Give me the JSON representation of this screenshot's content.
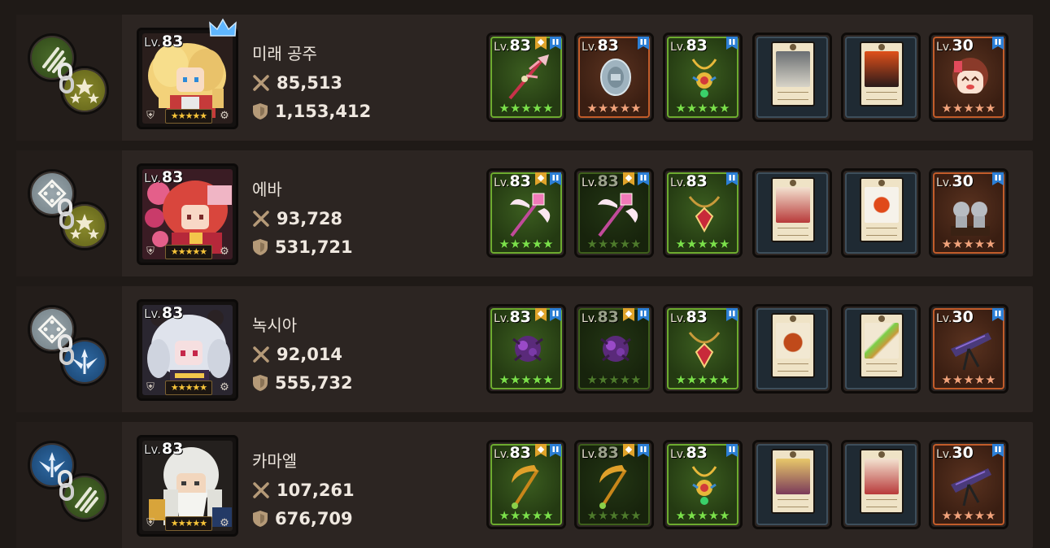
{
  "colors": {
    "background": "#1f1a17",
    "panel": "#2c2522",
    "star_gold": "#f6c339",
    "gear_green": "#6dab2f",
    "gear_orange": "#c25c2a",
    "badge_blue": "#2c7fd6"
  },
  "level_prefix": "Lv.",
  "heroes": [
    {
      "name": "미래 공주",
      "level": "83",
      "atk": "85,513",
      "def": "1,153,412",
      "stars": "★★★★★",
      "crown": true,
      "chain_icons": [
        "claw-icon",
        "triple-star-icon"
      ],
      "class_icon": "shield-class-icon",
      "element_icon": "gear-element-icon",
      "gear": [
        {
          "type": "weapon",
          "level": "83",
          "frame": "green",
          "icon": "spear-icon",
          "stars": "★★★★★",
          "badges": [
            "blue",
            "gold"
          ]
        },
        {
          "type": "armor",
          "level": "83",
          "frame": "orange",
          "icon": "shield-plate-icon",
          "stars": "★★★★★",
          "badges": [
            "blue"
          ]
        },
        {
          "type": "accessory",
          "level": "83",
          "frame": "green",
          "icon": "amulet-icon",
          "stars": "★★★★★",
          "badges": [
            "blue"
          ]
        },
        {
          "type": "card",
          "frame": "card",
          "icon": "old-man-card-icon"
        },
        {
          "type": "card",
          "frame": "card",
          "icon": "demon-card-icon"
        },
        {
          "type": "relic",
          "level": "30",
          "frame": "orange",
          "icon": "girl-doll-icon",
          "stars": "★★★★★",
          "badges": [
            "blue"
          ]
        }
      ]
    },
    {
      "name": "에바",
      "level": "83",
      "atk": "93,728",
      "def": "531,721",
      "stars": "★★★★★",
      "crown": false,
      "chain_icons": [
        "dice-icon",
        "triple-star-icon"
      ],
      "class_icon": "tree-class-icon",
      "element_icon": "diamond-element-icon",
      "gear": [
        {
          "type": "weapon",
          "level": "83",
          "frame": "green",
          "icon": "winged-staff-icon",
          "stars": "★★★★★",
          "badges": [
            "blue",
            "gold"
          ]
        },
        {
          "type": "weapon",
          "level": "83",
          "frame": "green-dim",
          "icon": "winged-staff-icon",
          "stars": "★★★★★",
          "badges": [
            "blue",
            "gold"
          ]
        },
        {
          "type": "accessory",
          "level": "83",
          "frame": "green",
          "icon": "ruby-necklace-icon",
          "stars": "★★★★★",
          "badges": [
            "blue"
          ]
        },
        {
          "type": "card",
          "frame": "card",
          "icon": "fox-girl-card-icon"
        },
        {
          "type": "card",
          "frame": "card",
          "icon": "food-plate-card-icon"
        },
        {
          "type": "relic",
          "level": "30",
          "frame": "orange",
          "icon": "twin-statue-icon",
          "stars": "★★★★★",
          "badges": [
            "blue"
          ]
        }
      ]
    },
    {
      "name": "녹시아",
      "level": "83",
      "atk": "92,014",
      "def": "555,732",
      "stars": "★★★★★",
      "crown": false,
      "chain_icons": [
        "dice-icon",
        "winged-arrow-icon"
      ],
      "class_icon": "tree-class-icon",
      "element_icon": "moon-element-icon",
      "gear": [
        {
          "type": "weapon",
          "level": "83",
          "frame": "green",
          "icon": "dark-orb-icon",
          "stars": "★★★★★",
          "badges": [
            "blue",
            "gold"
          ]
        },
        {
          "type": "weapon",
          "level": "83",
          "frame": "green-dim",
          "icon": "dark-orb-icon",
          "stars": "★★★★★",
          "badges": [
            "blue",
            "gold"
          ]
        },
        {
          "type": "accessory",
          "level": "83",
          "frame": "green",
          "icon": "ruby-necklace-icon",
          "stars": "★★★★★",
          "badges": [
            "blue"
          ]
        },
        {
          "type": "card",
          "frame": "card",
          "icon": "jar-card-icon"
        },
        {
          "type": "card",
          "frame": "card",
          "icon": "sword-card-icon"
        },
        {
          "type": "relic",
          "level": "30",
          "frame": "orange",
          "icon": "dark-blade-stand-icon",
          "stars": "★★★★★",
          "badges": [
            "blue"
          ]
        }
      ]
    },
    {
      "name": "카마엘",
      "level": "83",
      "atk": "107,261",
      "def": "676,709",
      "stars": "★★★★★",
      "crown": false,
      "chain_icons": [
        "winged-arrow-icon",
        "claw-icon"
      ],
      "class_icon": "tree-class-icon",
      "element_icon": "mountain-element-icon",
      "gear": [
        {
          "type": "weapon",
          "level": "83",
          "frame": "green",
          "icon": "golden-scythe-icon",
          "stars": "★★★★★",
          "badges": [
            "blue",
            "gold"
          ]
        },
        {
          "type": "weapon",
          "level": "83",
          "frame": "green-dim",
          "icon": "golden-scythe-icon",
          "stars": "★★★★★",
          "badges": [
            "blue",
            "gold"
          ]
        },
        {
          "type": "accessory",
          "level": "83",
          "frame": "green",
          "icon": "amulet-icon",
          "stars": "★★★★★",
          "badges": [
            "blue"
          ]
        },
        {
          "type": "card",
          "frame": "card",
          "icon": "blonde-girl-card-icon"
        },
        {
          "type": "card",
          "frame": "card",
          "icon": "fox-girl-card-icon"
        },
        {
          "type": "relic",
          "level": "30",
          "frame": "orange",
          "icon": "dark-blade-stand-icon",
          "stars": "★★★★★",
          "badges": [
            "blue"
          ]
        }
      ]
    }
  ]
}
